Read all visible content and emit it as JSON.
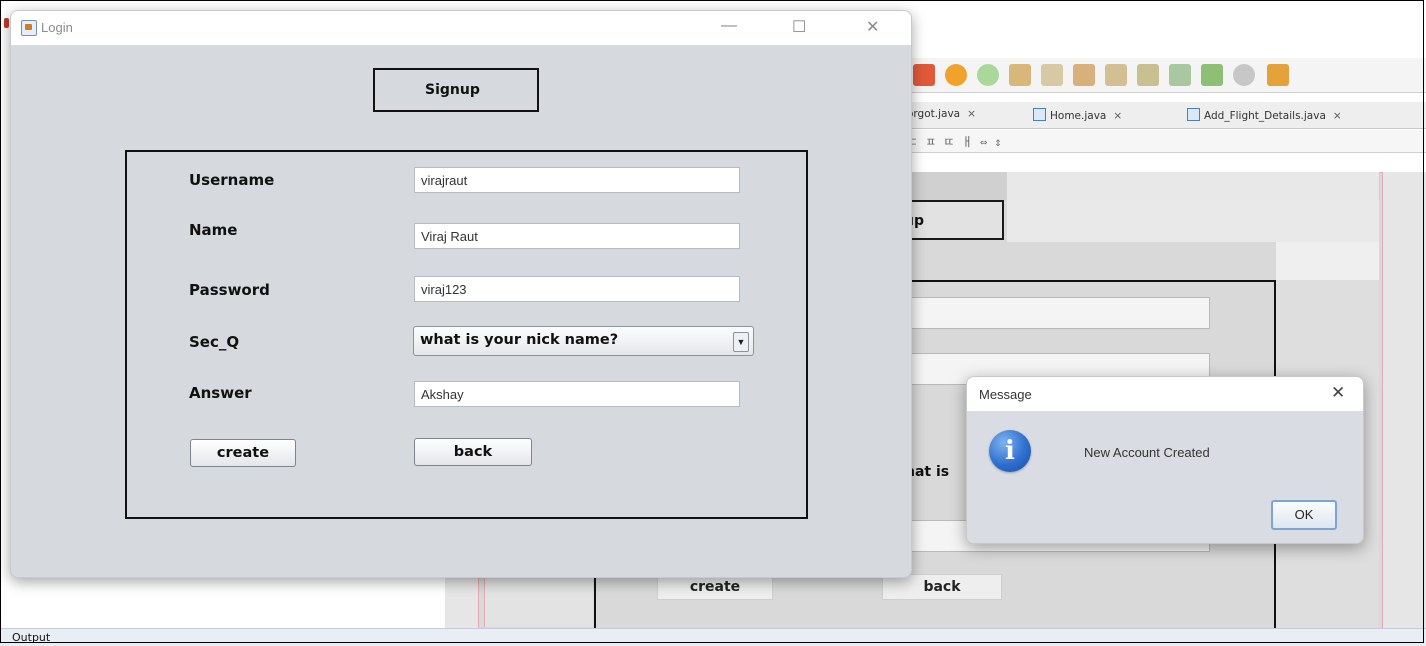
{
  "colors": {
    "dialog_bg": "#d6d9de",
    "ide_bg": "#e6e6e6",
    "output_bar": "#e9eef4",
    "info_icon": "#2e6fcf"
  },
  "ide": {
    "tabs": [
      {
        "label": "orgot.java",
        "close": "×"
      },
      {
        "label": "Home.java",
        "close": "×"
      },
      {
        "label": "Add_Flight_Details.java",
        "close": "×"
      }
    ],
    "designbar_glyphs": "ㄷ ㅍ ㄸ ㅐ  ⇔ ⇕",
    "design_signup_partial": "gnup",
    "design_field_partial": "hat is",
    "design_create": "create",
    "design_back": "back",
    "output_label": "Output",
    "toolbar_icons": [
      "stop-icon",
      "pause-icon",
      "run-icon",
      "clean-icon",
      "build-icon",
      "download-icon",
      "upload-icon",
      "commit-icon",
      "pull-icon",
      "tree-icon",
      "pause-circle-icon",
      "camera-icon"
    ]
  },
  "login": {
    "title": "Login",
    "controls": {
      "minimize": "—",
      "maximize": "☐",
      "close": "✕"
    },
    "signup_label": "Signup",
    "fields": {
      "username_label": "Username",
      "username_value": "virajraut",
      "name_label": "Name",
      "name_value": "Viraj Raut",
      "password_label": "Password",
      "password_value": "viraj123",
      "secq_label": "Sec_Q",
      "secq_value": "what is your nick name?",
      "answer_label": "Answer",
      "answer_value": "Akshay"
    },
    "create_label": "create",
    "back_label": "back"
  },
  "message": {
    "title": "Message",
    "close": "✕",
    "icon_glyph": "i",
    "text": "New Account Created",
    "ok_label": "OK"
  }
}
